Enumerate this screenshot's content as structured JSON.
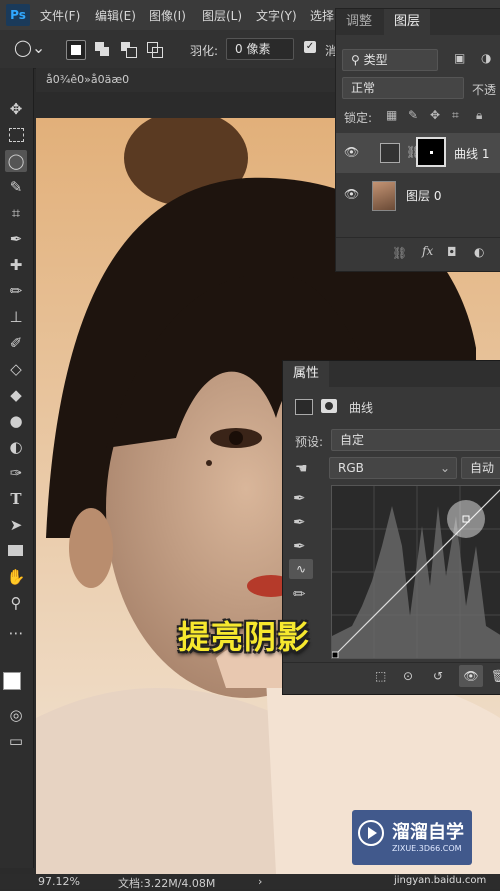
{
  "menu": [
    "文件(F)",
    "编辑(E)",
    "图像(I)",
    "图层(L)",
    "文字(Y)",
    "选择"
  ],
  "options": {
    "feather_label": "羽化:",
    "feather_value": "0 像素",
    "clear_partial": "消"
  },
  "doc_tab": "å0¾ê0»å0äæ0",
  "layers_panel": {
    "tabs": [
      "调整",
      "图层"
    ],
    "filter": "类型",
    "blend_mode": "正常",
    "opacity_partial": "不透",
    "lock_label": "锁定:",
    "layers": [
      {
        "name": "曲线 1"
      },
      {
        "name": "图层 0"
      }
    ]
  },
  "properties_panel": {
    "title": "属性",
    "adjustment_name": "曲线",
    "preset_label": "预设:",
    "preset_value": "自定",
    "channel": "RGB",
    "auto_button": "自动"
  },
  "caption": "提亮阴影",
  "status": {
    "zoom": "97.12%",
    "doc_info": "文档:3.22M/4.08M"
  },
  "watermark": {
    "brand": "溜溜自学",
    "url": "ZIXUE.3D66.COM",
    "footer": "jingyan.baidu.com"
  },
  "colors": {
    "caption": "#f6e82e",
    "panel_bg": "#383838",
    "watermark_bg": "#2c4a86"
  }
}
